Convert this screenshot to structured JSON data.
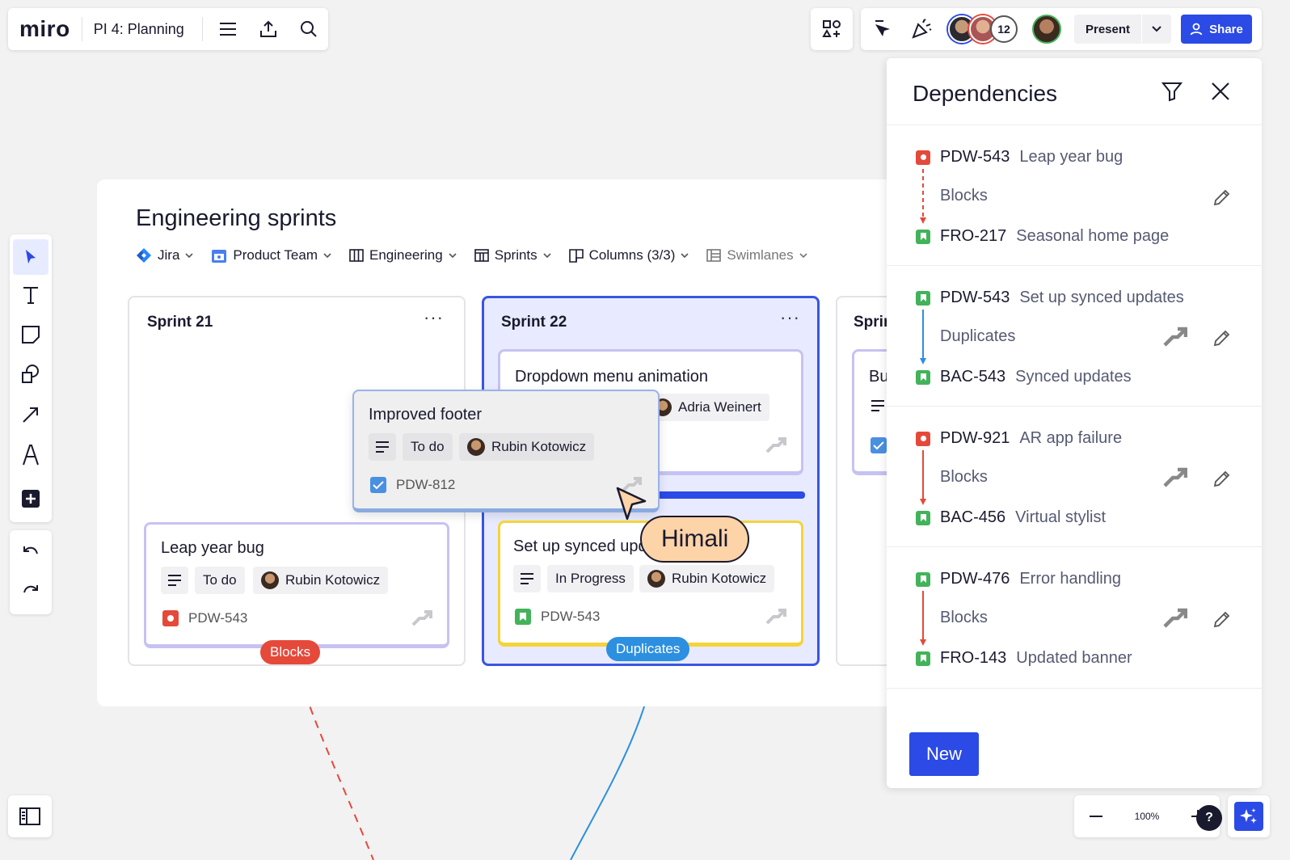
{
  "topbar": {
    "logo": "miro",
    "board_name": "PI 4: Planning",
    "collaborator_count": "12",
    "present_label": "Present",
    "share_label": "Share"
  },
  "frame": {
    "title": "Engineering sprints",
    "filters": [
      {
        "label": "Jira",
        "icon": "jira-icon"
      },
      {
        "label": "Product Team",
        "icon": "calendar-icon"
      },
      {
        "label": "Engineering",
        "icon": "columns-icon"
      },
      {
        "label": "Sprints",
        "icon": "table-icon"
      },
      {
        "label": "Columns (3/3)",
        "icon": "board-icon"
      },
      {
        "label": "Swimlanes",
        "icon": "swimlanes-icon"
      }
    ]
  },
  "columns": [
    {
      "title": "Sprint 21"
    },
    {
      "title": "Sprint 22"
    },
    {
      "title": "Sprir"
    }
  ],
  "cards": {
    "dropdown": {
      "title": "Dropdown menu animation",
      "assignee": "Adria Weinert"
    },
    "footer": {
      "title": "Improved footer",
      "status": "To do",
      "assignee": "Rubin Kotowicz",
      "key": "PDW-812"
    },
    "leap": {
      "title": "Leap year bug",
      "status": "To do",
      "assignee": "Rubin Kotowicz",
      "key": "PDW-543"
    },
    "synced": {
      "title": "Set up synced upd",
      "status": "In Progress",
      "assignee": "Rubin Kotowicz",
      "key": "PDW-543"
    },
    "partial": {
      "title": "Bu"
    }
  },
  "badges": {
    "blocks": "Blocks",
    "duplicates": "Duplicates"
  },
  "cursor": {
    "name": "Himali"
  },
  "panel": {
    "title": "Dependencies",
    "items": [
      {
        "from_key": "PDW-543",
        "from_name": "Leap year bug",
        "from_type": "bug",
        "relation": "Blocks",
        "to_key": "FRO-217",
        "to_name": "Seasonal home page",
        "to_type": "story"
      },
      {
        "from_key": "PDW-543",
        "from_name": "Set up synced updates",
        "from_type": "story",
        "relation": "Duplicates",
        "to_key": "BAC-543",
        "to_name": "Synced updates",
        "to_type": "story"
      },
      {
        "from_key": "PDW-921",
        "from_name": "AR app failure",
        "from_type": "bug",
        "relation": "Blocks",
        "to_key": "BAC-456",
        "to_name": "Virtual stylist",
        "to_type": "story"
      },
      {
        "from_key": "PDW-476",
        "from_name": "Error handling",
        "from_type": "story",
        "relation": "Blocks",
        "to_key": "FRO-143",
        "to_name": "Updated banner",
        "to_type": "story"
      }
    ],
    "new_label": "New"
  },
  "zoom": {
    "level": "100%"
  },
  "help_label": "?",
  "colors": {
    "accent": "#2b4ae6",
    "blocks": "#e5493a",
    "duplicates": "#2d8fe0",
    "story": "#42b35a",
    "bug": "#e5493a",
    "cursor": "#fdd3a8"
  }
}
